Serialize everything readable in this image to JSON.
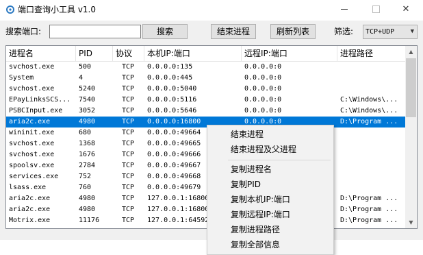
{
  "window": {
    "title": "端口查询小工具  v1.0",
    "minimize_glyph": "—",
    "close_glyph": "✕"
  },
  "toolbar": {
    "search_label": "搜索端口:",
    "search_value": "",
    "search_button": "搜索",
    "end_process_button": "结束进程",
    "refresh_button": "刷新列表",
    "filter_label": "筛选:",
    "filter_value": "TCP+UDP"
  },
  "table": {
    "columns": [
      "进程名",
      "PID",
      "协议",
      "本机IP:端口",
      "远程IP:端口",
      "进程路径"
    ],
    "rows": [
      {
        "name": "svchost.exe",
        "pid": "500",
        "proto": "TCP",
        "local": "0.0.0.0:135",
        "remote": "0.0.0.0:0",
        "path": ""
      },
      {
        "name": "System",
        "pid": "4",
        "proto": "TCP",
        "local": "0.0.0.0:445",
        "remote": "0.0.0.0:0",
        "path": ""
      },
      {
        "name": "svchost.exe",
        "pid": "5240",
        "proto": "TCP",
        "local": "0.0.0.0:5040",
        "remote": "0.0.0.0:0",
        "path": ""
      },
      {
        "name": "EPayLinksSCS...",
        "pid": "7540",
        "proto": "TCP",
        "local": "0.0.0.0:5116",
        "remote": "0.0.0.0:0",
        "path": "C:\\Windows\\..."
      },
      {
        "name": "PSBCInput.exe",
        "pid": "3052",
        "proto": "TCP",
        "local": "0.0.0.0:5646",
        "remote": "0.0.0.0:0",
        "path": "C:\\Windows\\..."
      },
      {
        "name": "aria2c.exe",
        "pid": "4980",
        "proto": "TCP",
        "local": "0.0.0.0:16800",
        "remote": "0.0.0.0:0",
        "path": "D:\\Program ...",
        "selected": true
      },
      {
        "name": "wininit.exe",
        "pid": "680",
        "proto": "TCP",
        "local": "0.0.0.0:49664",
        "remote": "",
        "path": ""
      },
      {
        "name": "svchost.exe",
        "pid": "1368",
        "proto": "TCP",
        "local": "0.0.0.0:49665",
        "remote": "",
        "path": ""
      },
      {
        "name": "svchost.exe",
        "pid": "1676",
        "proto": "TCP",
        "local": "0.0.0.0:49666",
        "remote": "",
        "path": ""
      },
      {
        "name": "spoolsv.exe",
        "pid": "2784",
        "proto": "TCP",
        "local": "0.0.0.0:49667",
        "remote": "",
        "path": ""
      },
      {
        "name": "services.exe",
        "pid": "752",
        "proto": "TCP",
        "local": "0.0.0.0:49668",
        "remote": "",
        "path": ""
      },
      {
        "name": "lsass.exe",
        "pid": "760",
        "proto": "TCP",
        "local": "0.0.0.0:49679",
        "remote": "",
        "path": ""
      },
      {
        "name": "aria2c.exe",
        "pid": "4980",
        "proto": "TCP",
        "local": "127.0.0.1:16800",
        "remote": "",
        "path": "D:\\Program ..."
      },
      {
        "name": "aria2c.exe",
        "pid": "4980",
        "proto": "TCP",
        "local": "127.0.0.1:16800",
        "remote": "",
        "path": "D:\\Program ..."
      },
      {
        "name": "Motrix.exe",
        "pid": "11176",
        "proto": "TCP",
        "local": "127.0.0.1:64592",
        "remote": "",
        "path": "D:\\Program ..."
      }
    ]
  },
  "context_menu": {
    "items": [
      {
        "label": "结束进程"
      },
      {
        "label": "结束进程及父进程"
      },
      {
        "label": "复制进程名"
      },
      {
        "label": "复制PID"
      },
      {
        "label": "复制本机IP:端口"
      },
      {
        "label": "复制远程IP:端口"
      },
      {
        "label": "复制进程路径"
      },
      {
        "label": "复制全部信息"
      }
    ]
  },
  "colors": {
    "selection": "#0078d7",
    "client_bg": "#f0f0f0"
  }
}
